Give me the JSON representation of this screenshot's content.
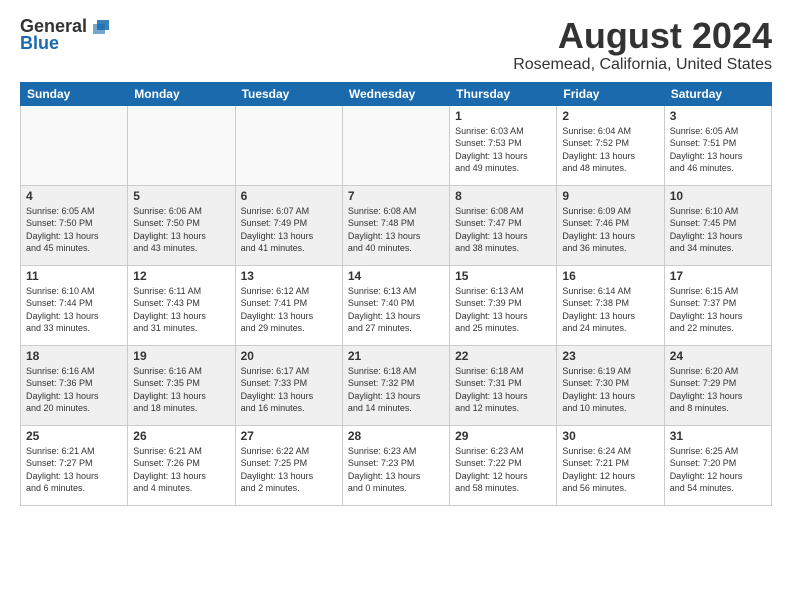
{
  "logo": {
    "general": "General",
    "blue": "Blue"
  },
  "title": "August 2024",
  "subtitle": "Rosemead, California, United States",
  "days_of_week": [
    "Sunday",
    "Monday",
    "Tuesday",
    "Wednesday",
    "Thursday",
    "Friday",
    "Saturday"
  ],
  "weeks": [
    [
      {
        "num": "",
        "text": ""
      },
      {
        "num": "",
        "text": ""
      },
      {
        "num": "",
        "text": ""
      },
      {
        "num": "",
        "text": ""
      },
      {
        "num": "1",
        "text": "Sunrise: 6:03 AM\nSunset: 7:53 PM\nDaylight: 13 hours\nand 49 minutes."
      },
      {
        "num": "2",
        "text": "Sunrise: 6:04 AM\nSunset: 7:52 PM\nDaylight: 13 hours\nand 48 minutes."
      },
      {
        "num": "3",
        "text": "Sunrise: 6:05 AM\nSunset: 7:51 PM\nDaylight: 13 hours\nand 46 minutes."
      }
    ],
    [
      {
        "num": "4",
        "text": "Sunrise: 6:05 AM\nSunset: 7:50 PM\nDaylight: 13 hours\nand 45 minutes."
      },
      {
        "num": "5",
        "text": "Sunrise: 6:06 AM\nSunset: 7:50 PM\nDaylight: 13 hours\nand 43 minutes."
      },
      {
        "num": "6",
        "text": "Sunrise: 6:07 AM\nSunset: 7:49 PM\nDaylight: 13 hours\nand 41 minutes."
      },
      {
        "num": "7",
        "text": "Sunrise: 6:08 AM\nSunset: 7:48 PM\nDaylight: 13 hours\nand 40 minutes."
      },
      {
        "num": "8",
        "text": "Sunrise: 6:08 AM\nSunset: 7:47 PM\nDaylight: 13 hours\nand 38 minutes."
      },
      {
        "num": "9",
        "text": "Sunrise: 6:09 AM\nSunset: 7:46 PM\nDaylight: 13 hours\nand 36 minutes."
      },
      {
        "num": "10",
        "text": "Sunrise: 6:10 AM\nSunset: 7:45 PM\nDaylight: 13 hours\nand 34 minutes."
      }
    ],
    [
      {
        "num": "11",
        "text": "Sunrise: 6:10 AM\nSunset: 7:44 PM\nDaylight: 13 hours\nand 33 minutes."
      },
      {
        "num": "12",
        "text": "Sunrise: 6:11 AM\nSunset: 7:43 PM\nDaylight: 13 hours\nand 31 minutes."
      },
      {
        "num": "13",
        "text": "Sunrise: 6:12 AM\nSunset: 7:41 PM\nDaylight: 13 hours\nand 29 minutes."
      },
      {
        "num": "14",
        "text": "Sunrise: 6:13 AM\nSunset: 7:40 PM\nDaylight: 13 hours\nand 27 minutes."
      },
      {
        "num": "15",
        "text": "Sunrise: 6:13 AM\nSunset: 7:39 PM\nDaylight: 13 hours\nand 25 minutes."
      },
      {
        "num": "16",
        "text": "Sunrise: 6:14 AM\nSunset: 7:38 PM\nDaylight: 13 hours\nand 24 minutes."
      },
      {
        "num": "17",
        "text": "Sunrise: 6:15 AM\nSunset: 7:37 PM\nDaylight: 13 hours\nand 22 minutes."
      }
    ],
    [
      {
        "num": "18",
        "text": "Sunrise: 6:16 AM\nSunset: 7:36 PM\nDaylight: 13 hours\nand 20 minutes."
      },
      {
        "num": "19",
        "text": "Sunrise: 6:16 AM\nSunset: 7:35 PM\nDaylight: 13 hours\nand 18 minutes."
      },
      {
        "num": "20",
        "text": "Sunrise: 6:17 AM\nSunset: 7:33 PM\nDaylight: 13 hours\nand 16 minutes."
      },
      {
        "num": "21",
        "text": "Sunrise: 6:18 AM\nSunset: 7:32 PM\nDaylight: 13 hours\nand 14 minutes."
      },
      {
        "num": "22",
        "text": "Sunrise: 6:18 AM\nSunset: 7:31 PM\nDaylight: 13 hours\nand 12 minutes."
      },
      {
        "num": "23",
        "text": "Sunrise: 6:19 AM\nSunset: 7:30 PM\nDaylight: 13 hours\nand 10 minutes."
      },
      {
        "num": "24",
        "text": "Sunrise: 6:20 AM\nSunset: 7:29 PM\nDaylight: 13 hours\nand 8 minutes."
      }
    ],
    [
      {
        "num": "25",
        "text": "Sunrise: 6:21 AM\nSunset: 7:27 PM\nDaylight: 13 hours\nand 6 minutes."
      },
      {
        "num": "26",
        "text": "Sunrise: 6:21 AM\nSunset: 7:26 PM\nDaylight: 13 hours\nand 4 minutes."
      },
      {
        "num": "27",
        "text": "Sunrise: 6:22 AM\nSunset: 7:25 PM\nDaylight: 13 hours\nand 2 minutes."
      },
      {
        "num": "28",
        "text": "Sunrise: 6:23 AM\nSunset: 7:23 PM\nDaylight: 13 hours\nand 0 minutes."
      },
      {
        "num": "29",
        "text": "Sunrise: 6:23 AM\nSunset: 7:22 PM\nDaylight: 12 hours\nand 58 minutes."
      },
      {
        "num": "30",
        "text": "Sunrise: 6:24 AM\nSunset: 7:21 PM\nDaylight: 12 hours\nand 56 minutes."
      },
      {
        "num": "31",
        "text": "Sunrise: 6:25 AM\nSunset: 7:20 PM\nDaylight: 12 hours\nand 54 minutes."
      }
    ]
  ],
  "alt_rows": [
    1,
    3
  ]
}
